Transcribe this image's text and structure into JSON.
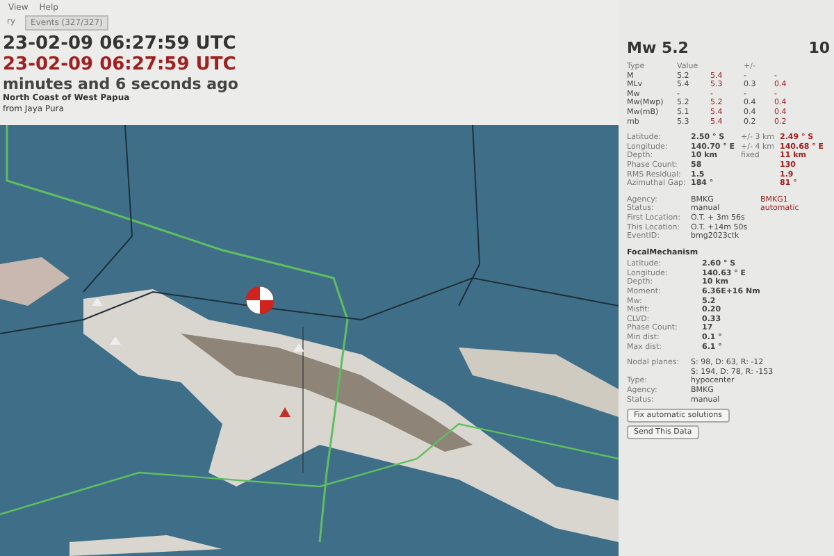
{
  "menu": [
    "View",
    "Help"
  ],
  "tabs": [
    {
      "label": "ry",
      "selected": false
    },
    {
      "label": "Events (327/327)",
      "selected": true
    }
  ],
  "header": {
    "origin_time": "23-02-09 06:27:59 UTC",
    "alt_time": "23-02-09 06:27:59 UTC",
    "ago": "minutes and 6 seconds ago",
    "region": "North Coast of West Papua",
    "nearby": "from Jaya Pura"
  },
  "summary": {
    "magnitude": "Mw 5.2",
    "partial": "10"
  },
  "magnitudes": {
    "columns": [
      "Type",
      "Value",
      "+/-"
    ],
    "rows": [
      {
        "type": "M",
        "value": "5.2",
        "value2": "5.4",
        "err": "-",
        "err2": "-"
      },
      {
        "type": "MLv",
        "value": "5.4",
        "value2": "5.3",
        "err": "0.3",
        "err2": "0.4"
      },
      {
        "type": "Mw",
        "value": "-",
        "value2": "-",
        "err": "-",
        "err2": "-"
      },
      {
        "type": "Mw(Mwp)",
        "value": "5.2",
        "value2": "5.2",
        "err": "0.4",
        "err2": "0.4"
      },
      {
        "type": "Mw(mB)",
        "value": "5.1",
        "value2": "5.4",
        "err": "0.4",
        "err2": "0.4"
      },
      {
        "type": "mb",
        "value": "5.3",
        "value2": "5.4",
        "err": "0.2",
        "err2": "0.2"
      }
    ]
  },
  "origin": [
    {
      "label": "Latitude:",
      "value": "2.50 ° S",
      "unc": "+/-  3 km",
      "value2": "2.49 ° S"
    },
    {
      "label": "Longitude:",
      "value": "140.70 ° E",
      "unc": "+/-  4 km",
      "value2": "140.68 ° E"
    },
    {
      "label": "Depth:",
      "value": "10 km",
      "unc": "fixed",
      "value2": "11 km"
    },
    {
      "label": "Phase Count:",
      "value": "58",
      "value2": "130"
    },
    {
      "label": "RMS Residual:",
      "value": "1.5",
      "value2": "1.9"
    },
    {
      "label": "Azimuthal Gap:",
      "value": "184 °",
      "value2": "81 °"
    }
  ],
  "info": [
    {
      "label": "Agency:",
      "value": "BMKG",
      "value2": "BMKG1"
    },
    {
      "label": "Status:",
      "value": "manual",
      "value2": "automatic"
    },
    {
      "label": "First Location:",
      "value": "O.T. + 3m 56s"
    },
    {
      "label": "This Location:",
      "value": "O.T. +14m 50s"
    },
    {
      "label": "EventID:",
      "value": "bmg2023ctk"
    }
  ],
  "focal": {
    "title": "FocalMechanism",
    "rows": [
      {
        "label": "Latitude:",
        "value": "2.60 ° S"
      },
      {
        "label": "Longitude:",
        "value": "140.63 ° E"
      },
      {
        "label": "Depth:",
        "value": "10 km"
      },
      {
        "label": "Moment:",
        "value": "6.36E+16 Nm"
      },
      {
        "label": "Mw:",
        "value": "5.2"
      },
      {
        "label": "Misfit:",
        "value": "0.20"
      },
      {
        "label": "CLVD:",
        "value": "0.33"
      },
      {
        "label": "Phase Count:",
        "value": "17"
      },
      {
        "label": "Min dist:",
        "value": "0.1 °"
      },
      {
        "label": "Max dist:",
        "value": "6.1 °"
      }
    ],
    "nodal_label": "Nodal planes:",
    "nodal_planes": [
      "S: 98, D: 63, R: -12",
      "S: 194, D: 78, R: -153"
    ],
    "extra": [
      {
        "label": "Type:",
        "value": "hypocenter"
      },
      {
        "label": "Agency:",
        "value": "BMKG"
      },
      {
        "label": "Status:",
        "value": "manual"
      }
    ]
  },
  "buttons": [
    "Fix automatic solutions",
    "Send This Data"
  ]
}
